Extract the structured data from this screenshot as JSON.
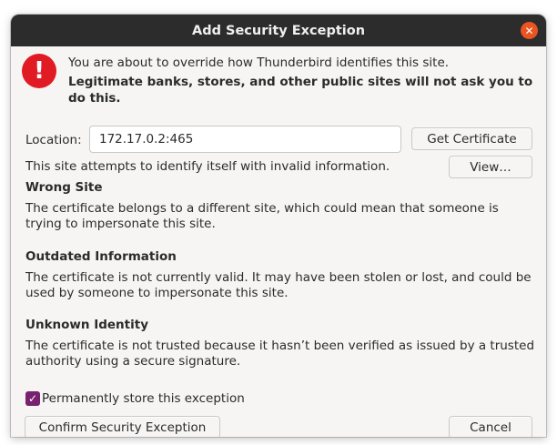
{
  "dialog": {
    "title": "Add Security Exception",
    "close_symbol": "✕"
  },
  "intro": {
    "line1": "You are about to override how Thunderbird identifies this site.",
    "line2": "Legitimate banks, stores, and other public sites will not ask you to do this."
  },
  "location": {
    "label": "Location:",
    "value": "172.17.0.2:465",
    "get_certificate_label": "Get Certificate"
  },
  "status": {
    "text": "This site attempts to identify itself with invalid information.",
    "view_label": "View…"
  },
  "sections": [
    {
      "title": "Wrong Site",
      "text": "The certificate belongs to a different site, which could mean that someone is trying to impersonate this site."
    },
    {
      "title": "Outdated Information",
      "text": "The certificate is not currently valid. It may have been stolen or lost, and could be used by someone to impersonate this site."
    },
    {
      "title": "Unknown Identity",
      "text": "The certificate is not trusted because it hasn’t been verified as issued by a trusted authority using a secure signature."
    }
  ],
  "permanent": {
    "label": "Permanently store this exception",
    "checked": true
  },
  "footer": {
    "confirm_label": "Confirm Security Exception",
    "cancel_label": "Cancel"
  },
  "icons": {
    "alert": "alert-icon",
    "close": "close-icon",
    "check": "check-icon"
  },
  "colors": {
    "titlebar": "#2c2c2c",
    "close_button": "#e95420",
    "alert_icon": "#e01b24",
    "checkbox": "#77216f"
  }
}
